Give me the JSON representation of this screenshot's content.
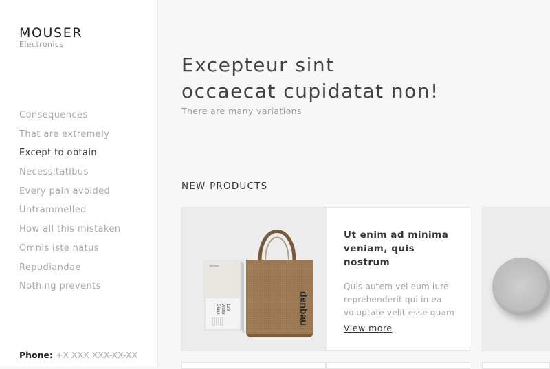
{
  "brand": {
    "name": "MOUSER",
    "subtitle": "Electronics"
  },
  "nav": {
    "items": [
      {
        "label": "Consequences",
        "active": false
      },
      {
        "label": "That are extremely",
        "active": false
      },
      {
        "label": "Except to obtain",
        "active": true
      },
      {
        "label": "Necessitatibus",
        "active": false
      },
      {
        "label": "Every pain avoided",
        "active": false
      },
      {
        "label": "Untrammelled",
        "active": false
      },
      {
        "label": "How all this mistaken",
        "active": false
      },
      {
        "label": "Omnis iste natus",
        "active": false
      },
      {
        "label": "Repudiandae",
        "active": false
      },
      {
        "label": "Nothing prevents",
        "active": false
      }
    ]
  },
  "contact": {
    "phone_label": "Phone:",
    "phone_value": "+X XXX XXX-XX-XX"
  },
  "hero": {
    "title_line1": "Excepteur sint",
    "title_line2": "occaecat cupidatat non!",
    "subtitle": "There are many variations"
  },
  "products": {
    "section_title": "NEW PRODUCTS",
    "items": [
      {
        "title": "Ut enim ad minima veniam, quis nostrum",
        "description": "Quis autem vel eum iure reprehenderit qui in ea voluptate velit esse quam",
        "link_label": "View more",
        "image": {
          "bag_brand": "denbau",
          "box_label_line1": "128",
          "box_label_line2": "Water",
          "box_label_line3": "Glass",
          "box_brand": "denbau"
        }
      }
    ]
  }
}
